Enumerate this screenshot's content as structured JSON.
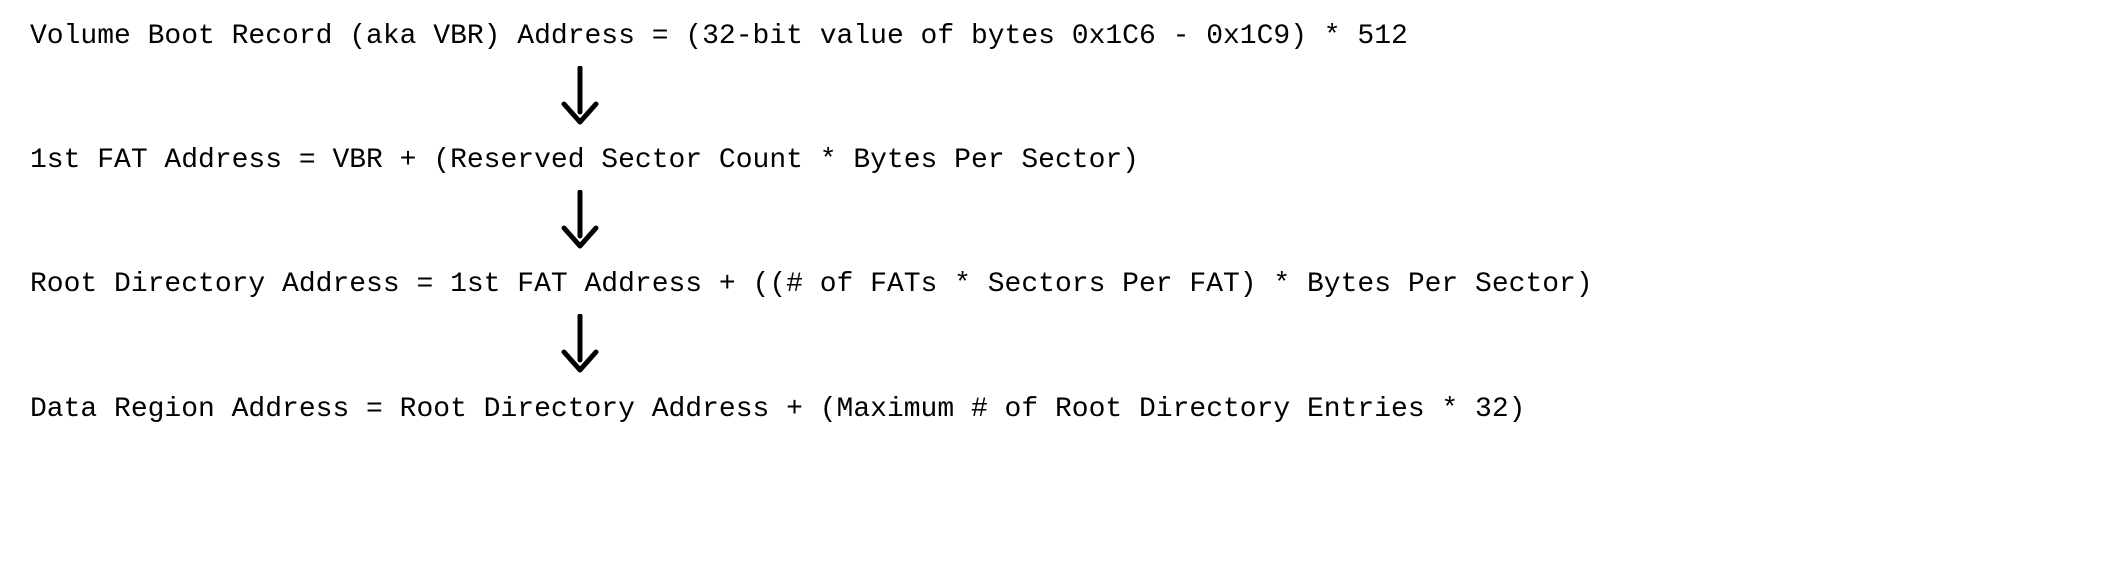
{
  "formulas": {
    "vbr": "Volume Boot Record (aka VBR) Address = (32-bit value of bytes 0x1C6 - 0x1C9) * 512",
    "fat": "1st FAT Address = VBR + (Reserved Sector Count * Bytes Per Sector)",
    "root": "Root Directory Address = 1st FAT Address + ((# of FATs * Sectors Per FAT) * Bytes Per Sector)",
    "data": "Data Region Address = Root Directory Address + (Maximum # of Root Directory Entries * 32)"
  }
}
